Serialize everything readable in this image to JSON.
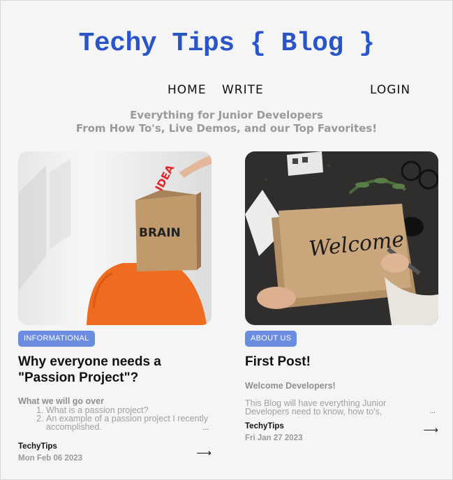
{
  "site": {
    "logo": "Techy Tips { Blog }"
  },
  "nav": {
    "home": "HOME",
    "write": "WRITE",
    "login": "LOGIN"
  },
  "tagline": {
    "line1": "Everything for Junior Developers",
    "line2": "From How To's, Live Demos, and our Top Favorites!"
  },
  "posts": [
    {
      "category": "INFORMATIONAL",
      "title": "Why everyone needs a \"Passion Project\"?",
      "subhead": "What we will go over",
      "list": [
        "What is a passion project?",
        "An example of a passion project I recently accomplished."
      ],
      "more": "...",
      "author": "TechyTips",
      "date": "Mon Feb 06 2023",
      "arrow": "⟶",
      "image_text": [
        "IDEA",
        "BRAIN"
      ],
      "icon": "arrow-right-icon"
    },
    {
      "category": "ABOUT US",
      "title": "First Post!",
      "subhead": "Welcome Developers!",
      "body": "This Blog will have everything Junior Developers need to know, how to's,",
      "more": "...",
      "author": "TechyTips",
      "date": "Fri Jan 27 2023",
      "arrow": "⟶",
      "image_text": [
        "Welcome"
      ],
      "icon": "arrow-right-icon"
    }
  ],
  "colors": {
    "logo": "#2a55c8",
    "badge": "#6b8de0",
    "background": "#f5f5f5"
  }
}
